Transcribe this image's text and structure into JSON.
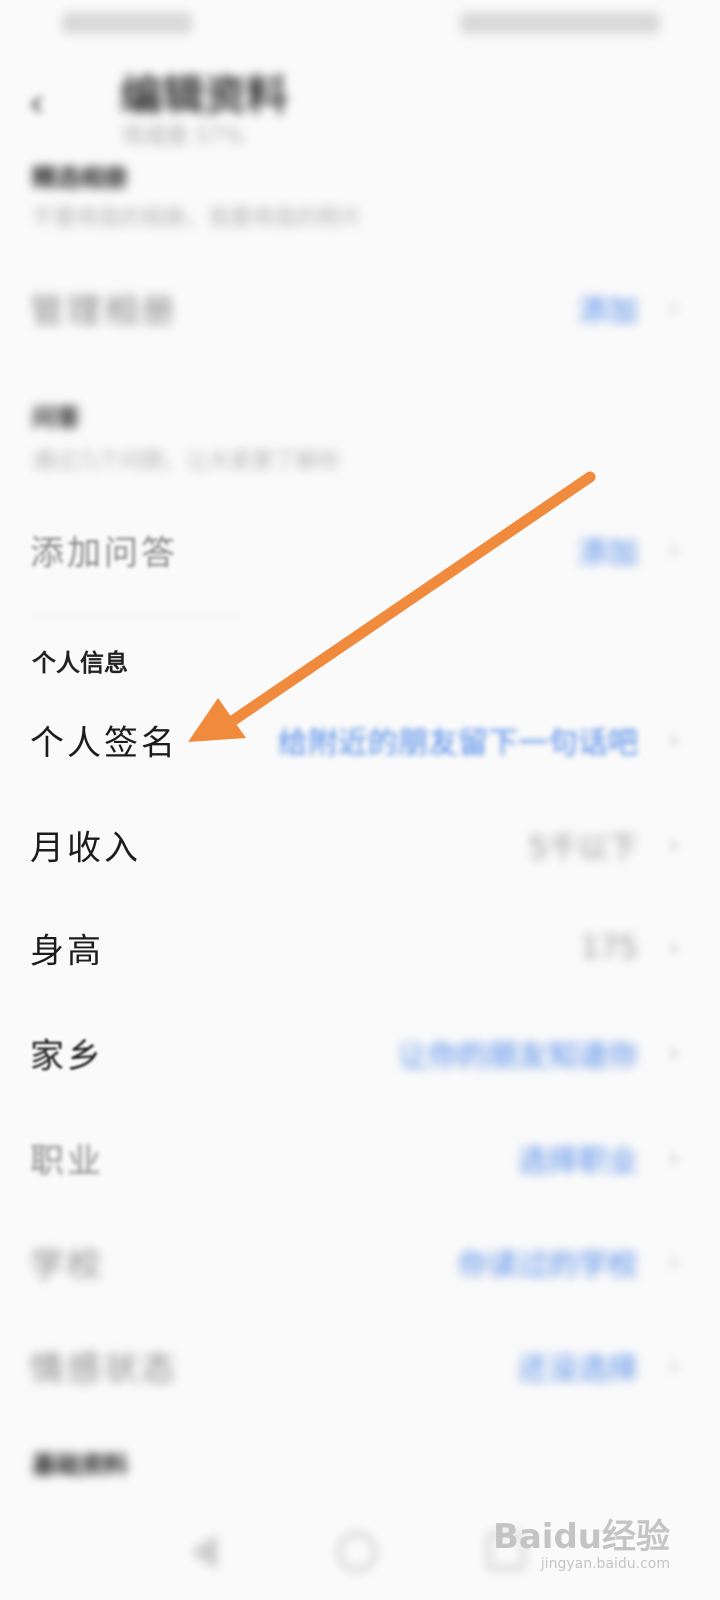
{
  "header": {
    "title": "编辑资料",
    "subtitle": "完成度 57%"
  },
  "sections": {
    "top_section_label": "精选相册",
    "top_section_hint": "不要用我的相册，我要用我的照片",
    "qa_label": "问答",
    "qa_hint": "通过几个问题，让大家更了解你",
    "personal_label": "个人信息",
    "bottom_label": "基础资料"
  },
  "rows": [
    {
      "label": "管理相册",
      "value": "添加"
    },
    {
      "label": "添加问答",
      "value": "添加"
    },
    {
      "label": "个人签名",
      "value": "给附近的朋友留下一句话吧"
    },
    {
      "label": "月收入",
      "value": "5千以下"
    },
    {
      "label": "身高",
      "value": "175"
    },
    {
      "label": "家乡",
      "value": "让你的朋友知道你"
    },
    {
      "label": "职业",
      "value": "选择职业"
    },
    {
      "label": "学校",
      "value": "你读过的学校"
    },
    {
      "label": "情感状态",
      "value": "还没选择"
    }
  ],
  "icons": {
    "back": "back-arrow-icon",
    "chevron": "chevron-right-icon"
  },
  "colors": {
    "accent_blue": "#4a86e8",
    "annotation_arrow": "#f08a3c",
    "text_dark": "#1c1c1c",
    "text_gray": "#999999"
  },
  "watermark": {
    "main": "Baidu经验",
    "sub": "jingyan.baidu.com"
  }
}
